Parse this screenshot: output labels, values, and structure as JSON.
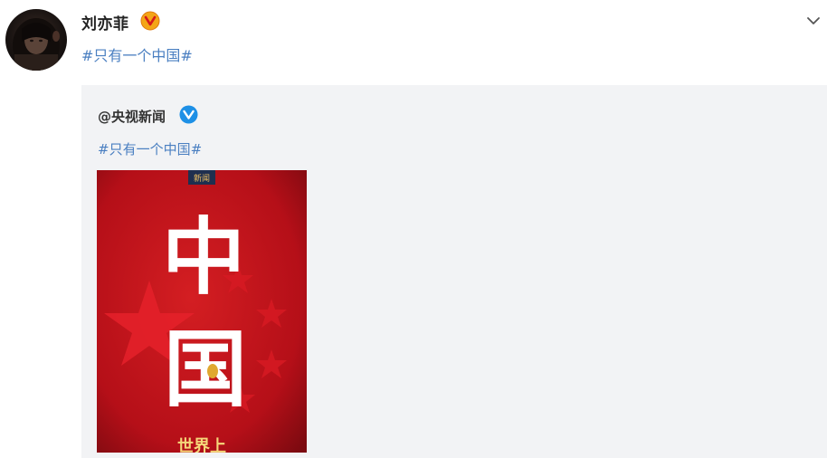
{
  "post": {
    "author": "刘亦菲",
    "hashtag": "#只有一个中国#"
  },
  "repost": {
    "author": "@央视新闻",
    "hashtag": "#只有一个中国#",
    "image": {
      "badge": "新闻",
      "title_char_1": "中",
      "title_char_2": "国",
      "bottom_text": "世界上"
    }
  },
  "colors": {
    "link": "#4a7fc1",
    "gold_badge": "#f4a516",
    "blue_badge": "#1e90e6",
    "poster_red": "#c8121b",
    "repost_bg": "#f2f3f5"
  },
  "icons": {
    "gold_verified": "verified-gold-icon",
    "blue_verified": "verified-blue-icon",
    "more": "chevron-down-icon"
  }
}
